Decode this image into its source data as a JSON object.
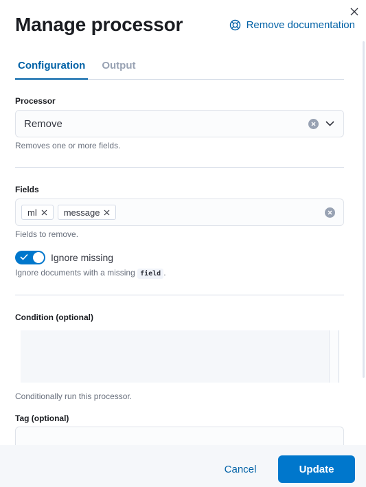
{
  "flyout": {
    "title": "Manage processor",
    "doc_link": "Remove documentation",
    "close_icon": "close-icon",
    "doc_icon": "lifebuoy-icon"
  },
  "tabs": [
    {
      "label": "Configuration",
      "active": true
    },
    {
      "label": "Output",
      "active": false
    }
  ],
  "processor": {
    "label": "Processor",
    "value": "Remove",
    "help": "Removes one or more fields."
  },
  "fields": {
    "label": "Fields",
    "values": [
      "ml",
      "message"
    ],
    "help": "Fields to remove."
  },
  "ignore_missing": {
    "label": "Ignore missing",
    "checked": true,
    "help_prefix": "Ignore documents with a missing",
    "help_code": "field",
    "help_suffix": "."
  },
  "condition": {
    "label": "Condition (optional)",
    "help": "Conditionally run this processor."
  },
  "tag": {
    "label": "Tag (optional)",
    "value": ""
  },
  "footer": {
    "cancel_label": "Cancel",
    "update_label": "Update"
  },
  "colors": {
    "primary": "#0077cc",
    "link": "#0061a6",
    "footer_bg": "#f5f7fa"
  }
}
